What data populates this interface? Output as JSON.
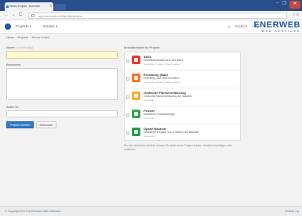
{
  "browser": {
    "tab_title": "Neues Projekt - Enerweb",
    "url": "app.enerweb.ch/#/projects/new",
    "window_buttons": [
      "–",
      "❐",
      "✕"
    ]
  },
  "appbar": {
    "menu_projects": "Projekte ▾",
    "menu_modules": "Module ▾",
    "right_item_1": "Konto ▾",
    "right_item_2": "Hilfe",
    "brand_main": "ENERWEB",
    "brand_sub": "WEB SERVICES"
  },
  "breadcrumb": {
    "home": "Home",
    "projects": "Projekte",
    "current": "Neues Projekt"
  },
  "form": {
    "name_label": "Name:",
    "name_hint": "(notwendig)",
    "name_value": "",
    "description_label": "Beschrieb:",
    "description_value": "",
    "created_by_label": "Akten Nr.",
    "created_by_value": "",
    "submit_label": "Projekt erstellen",
    "cancel_label": "Abbrechen"
  },
  "modules": {
    "title": "Modulauswahl für Projekt:",
    "items": [
      {
        "name": "380/1",
        "desc": "Heizwärmebedarf nach SIA 380/1",
        "meta": "Gemeinde / Kanton / Daten bauteil",
        "color": "#d9412e"
      },
      {
        "name": "Erstellung (Bau)",
        "desc": "Erstellung nach Bau SIA 380/1",
        "meta": "Gemeinde / Kanton / Daten bauteil",
        "color": "#ee7a2b"
      },
      {
        "name": "Grafische Flächenerfassung",
        "desc": "Grafische Flächenerfassung der Bauplan",
        "meta": "Gemeinde",
        "color": "#f2b233"
      },
      {
        "name": "Fenster",
        "desc": "Detaillierte Fensterenergie",
        "meta": "Gemeinde",
        "color": "#3aa34f"
      },
      {
        "name": "Opake Bauteile",
        "desc": "Detaillierte Eingabe von U-Werten der Bauteile",
        "meta": "Gemeinde",
        "color": "#2b9a4a"
      }
    ],
    "note": "Die hier aktivierten Module können Sie jederzeit im Projekt ändern, Module hinzufügen oder entfernen."
  },
  "footer": {
    "copyright": "© Copyright 2014 by",
    "company": "Enerweb Web Services",
    "version": "Version 1.4"
  }
}
